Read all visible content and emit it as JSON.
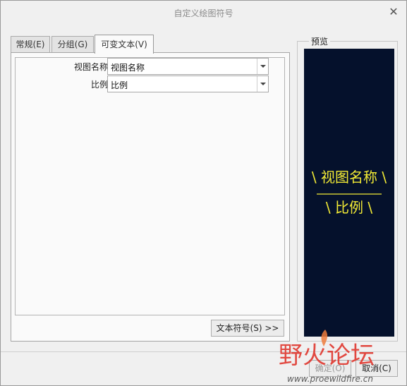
{
  "window": {
    "title": "自定义绘图符号"
  },
  "tabs": [
    {
      "label": "常规(E)"
    },
    {
      "label": "分组(G)"
    },
    {
      "label": "可变文本(V)"
    }
  ],
  "variable_text": {
    "rows": [
      {
        "label": "视图名称",
        "value": "视图名称"
      },
      {
        "label": "比例",
        "value": "比例"
      }
    ],
    "text_symbol_button": "文本符号(S) >>"
  },
  "preview": {
    "label": "预览",
    "line1": "\\ 视图名称 \\",
    "line2": "\\ 比例 \\",
    "background": "#05112c",
    "text_color": "#f2ea35"
  },
  "buttons": {
    "ok": "确定(O)",
    "cancel": "取消(C)"
  },
  "watermark": {
    "brand": "野火论坛",
    "url": "www.proewildfire.cn"
  }
}
